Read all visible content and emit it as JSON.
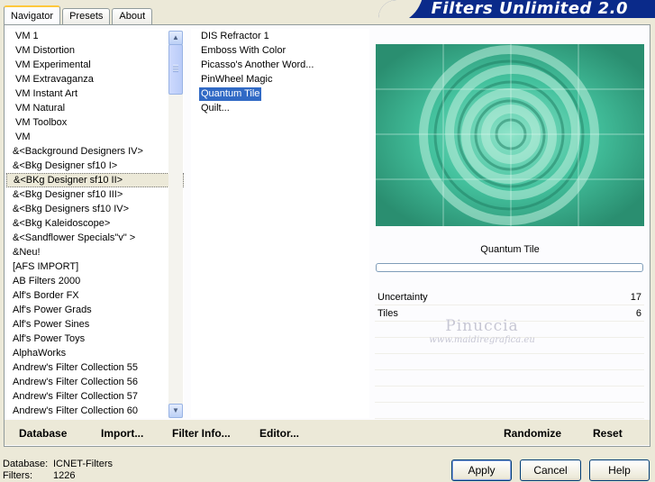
{
  "tabs": [
    "Navigator",
    "Presets",
    "About"
  ],
  "banner": "Filters Unlimited 2.0",
  "categories": [
    "VM 1",
    "VM Distortion",
    "VM Experimental",
    "VM Extravaganza",
    "VM Instant Art",
    "VM Natural",
    "VM Toolbox",
    "VM",
    "&<Background Designers IV>",
    "&<Bkg Designer sf10 I>",
    "&<BKg Designer sf10 II>",
    "&<Bkg Designer sf10 III>",
    "&<Bkg Designers sf10 IV>",
    "&<Bkg Kaleidoscope>",
    "&<Sandflower Specials\"v\" >",
    "&Neu!",
    "[AFS IMPORT]",
    "AB Filters 2000",
    "Alf's Border FX",
    "Alf's Power Grads",
    "Alf's Power Sines",
    "Alf's Power Toys",
    "AlphaWorks",
    "Andrew's Filter Collection 55",
    "Andrew's Filter Collection 56",
    "Andrew's Filter Collection 57",
    "Andrew's Filter Collection 60"
  ],
  "selected_category": "&<BKg Designer sf10 II>",
  "filters": [
    "DIS Refractor 1",
    "Emboss With Color",
    "Picasso's Another Word...",
    "PinWheel Magic",
    "Quantum Tile",
    "Quilt..."
  ],
  "selected_filter": "Quantum Tile",
  "filter_title": "Quantum Tile",
  "params": [
    {
      "name": "Uncertainty",
      "value": "17"
    },
    {
      "name": "Tiles",
      "value": "6"
    }
  ],
  "watermark": {
    "line1": "Pinuccia",
    "line2": "www.maidiregrafica.eu"
  },
  "actions": {
    "database": "Database",
    "import": "Import...",
    "filter_info": "Filter Info...",
    "editor": "Editor...",
    "randomize": "Randomize",
    "reset": "Reset"
  },
  "status": {
    "database_label": "Database:",
    "database_value": "ICNET-Filters",
    "filters_label": "Filters:",
    "filters_value": "1226"
  },
  "buttons": {
    "apply": "Apply",
    "cancel": "Cancel",
    "help": "Help"
  },
  "colors": {
    "banner": "#0a2a8a",
    "selection": "#316ac5",
    "preview_teal": "#52c9a6"
  }
}
